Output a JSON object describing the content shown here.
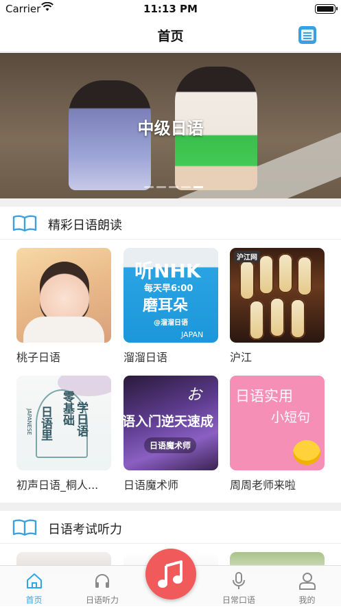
{
  "status_bar": {
    "carrier": "Carrier",
    "time": "11:13 PM"
  },
  "nav": {
    "title": "首页",
    "right_icon": "dictionary-icon"
  },
  "banner": {
    "label": "中级日语",
    "dots": 5,
    "active_dot": 4
  },
  "sections": [
    {
      "title": "精彩日语朗读",
      "icon": "open-book-icon",
      "items": [
        {
          "name": "桃子日语"
        },
        {
          "name": "溜溜日语",
          "thumb_text": {
            "l1": "听NHK",
            "l2": "每天早6:00",
            "l3": "磨耳朵",
            "l4": "@溜溜日语",
            "l5": "JAPAN"
          }
        },
        {
          "name": "沪江",
          "thumb_text": {
            "logo": "沪江网"
          }
        },
        {
          "name": "初声日语_桐人...",
          "thumb_text": {
            "v1": "零基础",
            "v2": "学日语",
            "v3": "日语里",
            "v4": "JAPANESE"
          }
        },
        {
          "name": "日语魔术师",
          "thumb_text": {
            "big": "语入门逆天速成",
            "o": "お",
            "pill": "日语魔术师"
          }
        },
        {
          "name": "周周老师来啦",
          "thumb_text": {
            "a": "日语实用",
            "b": "小短句"
          }
        }
      ]
    },
    {
      "title": "日语考试听力",
      "icon": "open-book-icon"
    }
  ],
  "tabbar": {
    "items": [
      {
        "label": "首页",
        "icon": "home-icon",
        "active": true
      },
      {
        "label": "日语听力",
        "icon": "headphones-icon",
        "active": false
      },
      {
        "label": "",
        "icon": "music-note-icon",
        "active": false
      },
      {
        "label": "日常口语",
        "icon": "microphone-icon",
        "active": false
      },
      {
        "label": "我的",
        "icon": "profile-icon",
        "active": false
      }
    ]
  },
  "colors": {
    "accent": "#2fa6e8",
    "center_button": "#f05a5a",
    "section_icon": "#3aa0e0"
  }
}
